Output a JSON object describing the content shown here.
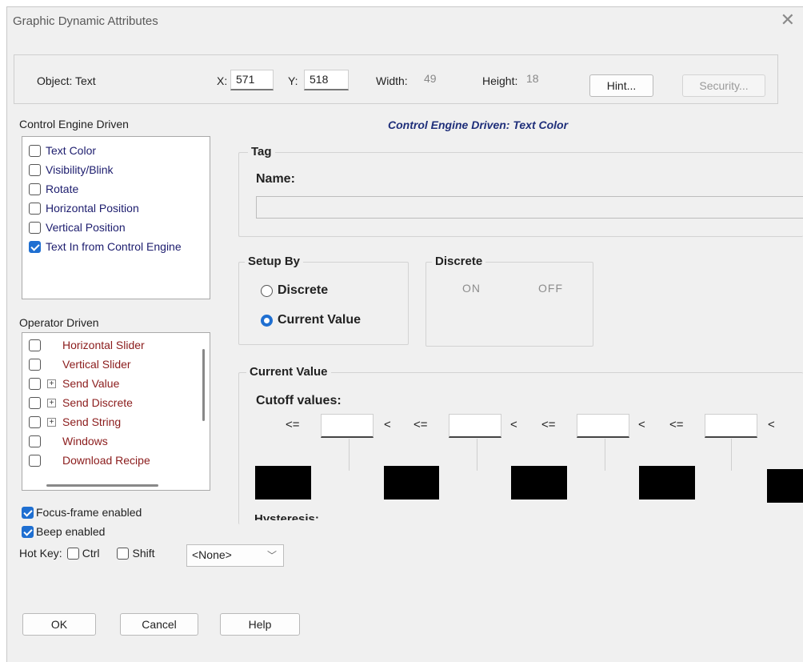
{
  "window": {
    "title": "Graphic Dynamic Attributes"
  },
  "object": {
    "label": "Object: Text",
    "x_label": "X:",
    "x_value": "571",
    "y_label": "Y:",
    "y_value": "518",
    "width_label": "Width:",
    "width_value": "49",
    "height_label": "Height:",
    "height_value": "18",
    "hint_button": "Hint...",
    "security_button": "Security..."
  },
  "control_engine": {
    "label": "Control Engine Driven",
    "items": [
      {
        "label": "Text Color",
        "checked": false
      },
      {
        "label": "Visibility/Blink",
        "checked": false
      },
      {
        "label": "Rotate",
        "checked": false
      },
      {
        "label": "Horizontal Position",
        "checked": false
      },
      {
        "label": "Vertical Position",
        "checked": false
      },
      {
        "label": "Text In from Control Engine",
        "checked": true
      }
    ]
  },
  "operator": {
    "label": "Operator Driven",
    "items": [
      {
        "label": "Horizontal Slider",
        "expandable": false
      },
      {
        "label": "Vertical Slider",
        "expandable": false
      },
      {
        "label": "Send Value",
        "expandable": true
      },
      {
        "label": "Send Discrete",
        "expandable": true
      },
      {
        "label": "Send String",
        "expandable": true
      },
      {
        "label": "Windows",
        "expandable": false
      },
      {
        "label": "Download Recipe",
        "expandable": false
      }
    ]
  },
  "options": {
    "focus_frame": "Focus-frame enabled",
    "beep": "Beep enabled",
    "hotkey_label": "Hot Key:",
    "ctrl": "Ctrl",
    "shift": "Shift",
    "hotkey_value": "<None>"
  },
  "caption": "Control Engine Driven: Text Color",
  "tag": {
    "title": "Tag",
    "name_label": "Name:"
  },
  "setup_by": {
    "title": "Setup By",
    "discrete": "Discrete",
    "current_value": "Current Value",
    "selected": "Current Value"
  },
  "discrete": {
    "title": "Discrete",
    "on": "ON",
    "off": "OFF"
  },
  "current_value": {
    "title": "Current Value",
    "cutoff_label": "Cutoff values:",
    "le": "<=",
    "lt": "<",
    "swatch_color": "#000000",
    "hysteresis_label": "Hysteresis:"
  },
  "buttons": {
    "ok": "OK",
    "cancel": "Cancel",
    "help": "Help"
  },
  "colors": {
    "accent": "#1f6fd1",
    "operator_text": "#8b1c1c",
    "control_text": "#1d1d6e",
    "caption": "#1f2f7a"
  }
}
